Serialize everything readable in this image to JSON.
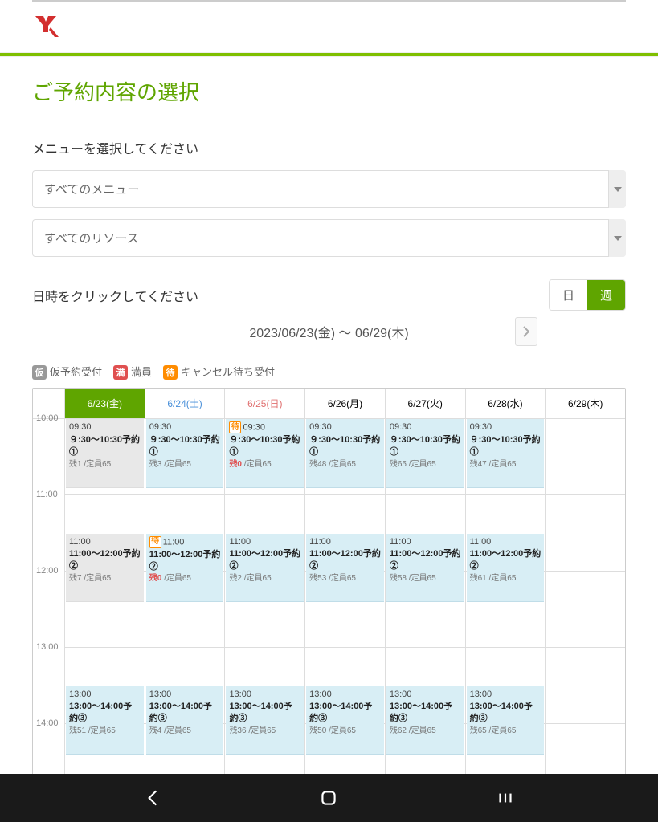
{
  "page_title": "ご予約内容の選択",
  "menu_label": "メニューを選択してください",
  "date_label": "日時をクリックしてください",
  "menu_select": "すべてのメニュー",
  "resource_select": "すべてのリソース",
  "date_range": "2023/06/23(金) 〜 06/29(木)",
  "view_day": "日",
  "view_week": "週",
  "legend": {
    "kari_badge": "仮",
    "kari": "仮予約受付",
    "man_badge": "満",
    "man": "満員",
    "machi_badge": "待",
    "machi": "キャンセル待ち受付"
  },
  "times": [
    "10:00",
    "11:00",
    "12:00",
    "13:00",
    "14:00"
  ],
  "days": [
    {
      "label": "6/23(金)",
      "cls": "active"
    },
    {
      "label": "6/24(土)",
      "cls": "sat"
    },
    {
      "label": "6/25(日)",
      "cls": "sun"
    },
    {
      "label": "6/26(月)",
      "cls": ""
    },
    {
      "label": "6/27(火)",
      "cls": ""
    },
    {
      "label": "6/28(水)",
      "cls": ""
    },
    {
      "label": "6/29(木)",
      "cls": ""
    }
  ],
  "capacity_label": "/定員65",
  "chart_data": {
    "type": "table",
    "title": "週間予約スケジュール 2023/06/23〜06/29",
    "columns": [
      "6/23(金)",
      "6/24(土)",
      "6/25(日)",
      "6/26(月)",
      "6/27(火)",
      "6/28(水)",
      "6/29(木)"
    ],
    "time_slots": [
      {
        "start": "09:30",
        "title": "９:30～10:30予約①",
        "capacity": 65,
        "remaining": [
          1,
          3,
          0,
          48,
          65,
          47,
          null
        ],
        "past": [
          true,
          false,
          false,
          false,
          false,
          false,
          false
        ],
        "wait": [
          false,
          false,
          true,
          false,
          false,
          false,
          false
        ]
      },
      {
        "start": "11:00",
        "title": "11:00～12:00予約②",
        "capacity": 65,
        "remaining": [
          7,
          0,
          2,
          53,
          58,
          61,
          null
        ],
        "past": [
          true,
          false,
          false,
          false,
          false,
          false,
          false
        ],
        "wait": [
          false,
          true,
          false,
          false,
          false,
          false,
          false
        ]
      },
      {
        "start": "13:00",
        "title": "13:00～14:00予約③",
        "capacity": 65,
        "remaining": [
          51,
          4,
          36,
          50,
          62,
          65,
          null
        ],
        "past": [
          false,
          false,
          false,
          false,
          false,
          false,
          false
        ],
        "wait": [
          false,
          false,
          false,
          false,
          false,
          false,
          false
        ]
      }
    ]
  }
}
